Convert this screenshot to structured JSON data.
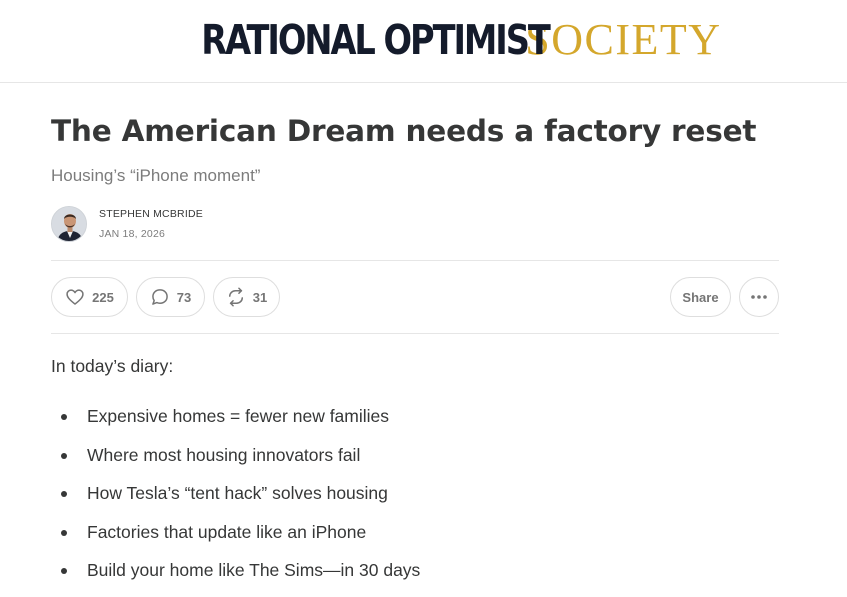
{
  "header": {
    "logo_primary": "RATIONAL OPTIMIST",
    "logo_secondary": "SOCIETY",
    "colors": {
      "primary": "#141b2b",
      "accent": "#d4a72c"
    }
  },
  "post": {
    "title": "The American Dream needs a factory reset",
    "subtitle": "Housing’s “iPhone moment”",
    "author": "STEPHEN MCBRIDE",
    "date": "JAN 18, 2026"
  },
  "actions": {
    "like": {
      "icon": "heart-icon",
      "count": "225"
    },
    "comment": {
      "icon": "comment-icon",
      "count": "73"
    },
    "restack": {
      "icon": "restack-icon",
      "count": "31"
    },
    "share_label": "Share",
    "more_icon": "more-icon"
  },
  "body": {
    "intro": "In today’s diary:",
    "bullets": [
      "Expensive homes = fewer new families",
      "Where most housing innovators fail",
      "How Tesla’s “tent hack” solves housing",
      "Factories that update like an iPhone",
      "Build your home like The Sims—in 30 days"
    ]
  }
}
